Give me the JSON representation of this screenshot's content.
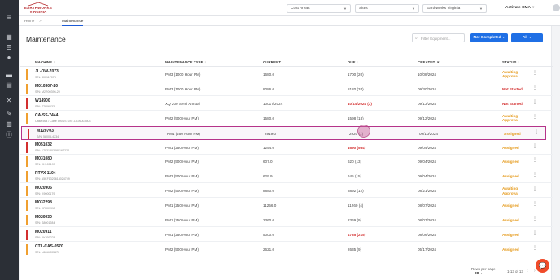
{
  "brand": {
    "logo_line1": "EARTHWORKS",
    "logo_line2": "VIRGINIA"
  },
  "sidebar": {
    "icons": [
      "menu-icon",
      "grid-icon",
      "list-icon",
      "user-icon",
      "truck-icon",
      "building-icon",
      "wrench-icon",
      "tool-icon",
      "chart-icon",
      "info-icon"
    ]
  },
  "topbar": {
    "cost_areas": "Cost Areas",
    "sites": "Sites",
    "company": "Earthworks Virginia",
    "user_name": "Activate CMA"
  },
  "breadcrumb": {
    "home": "Home",
    "current": "Maintenance"
  },
  "page": {
    "title": "Maintenance",
    "filter_placeholder": "Filter Equipment...",
    "status_filter": "Not Completed",
    "all_button": "All"
  },
  "table": {
    "headers": {
      "machine": "MACHINE",
      "type": "MAINTENANCE TYPE",
      "current": "CURRENT",
      "due": "DUE",
      "created": "CREATED",
      "status": "STATUS"
    },
    "rows": [
      {
        "name": "JL-OW-7073",
        "sn": "S/N: 300117073",
        "type": "PM3 (1000 Hour PM)",
        "current": "1680.0",
        "due": "1700 (20)",
        "due_red": false,
        "created": "10/08/2024",
        "status": "Awaiting Approval",
        "status_color": "#e59a1c",
        "flag": "#f0a030",
        "selected": false
      },
      {
        "name": "M010307-20",
        "sn": "S/N: M2R00396-20",
        "type": "PM3 (1000 Hour PM)",
        "current": "8086.0",
        "due": "8120 (34)",
        "due_red": false,
        "created": "09/30/2024",
        "status": "Not Started",
        "status_color": "#d32f2f",
        "flag": "#f0a030",
        "selected": false
      },
      {
        "name": "W14900",
        "sn": "S/N: 77906633",
        "type": "XQ 200 Semi Annual",
        "current": "10017/2024",
        "due": "10/14/2024 (3)",
        "due_red": true,
        "created": "09/13/2024",
        "status": "Not Started",
        "status_color": "#d32f2f",
        "flag": "#d32f2f",
        "selected": false
      },
      {
        "name": "CA-SS-7444",
        "sn": "Case 564 / Case 590SS S/N: JJGN0L5503",
        "type": "PM2 (500 Hour PM)",
        "current": "1580.0",
        "due": "1598 (18)",
        "due_red": false,
        "created": "09/12/2024",
        "status": "Awaiting Approval",
        "status_color": "#e59a1c",
        "flag": "#f0a030",
        "selected": false
      },
      {
        "name": "M120703",
        "sn": "S/N: 58005-4234",
        "type": "PM1 (250 Hour PM)",
        "current": "2919.0",
        "due": "2920 (1)",
        "due_red": false,
        "created": "09/10/2024",
        "status": "Assigned",
        "status_color": "#e59a1c",
        "flag": "#d32f2f",
        "selected": true
      },
      {
        "name": "M051032",
        "sn": "S/N: 17031303280167224",
        "type": "PM1 (250 Hour PM)",
        "current": "1254.0",
        "due": "1690 (564)",
        "due_red": true,
        "created": "09/04/2024",
        "status": "Assigned",
        "status_color": "#e59a1c",
        "flag": "#d32f2f",
        "selected": false
      },
      {
        "name": "M031080",
        "sn": "S/N: KKL00197",
        "type": "PM2 (500 Hour PM)",
        "current": "607.0",
        "due": "620 (13)",
        "due_red": false,
        "created": "09/04/2024",
        "status": "Assigned",
        "status_color": "#e59a1c",
        "flag": "#f0a030",
        "selected": false
      },
      {
        "name": "RTVX 1104",
        "sn": "S/N: A5KF1320614024749",
        "type": "PM2 (500 Hour PM)",
        "current": "629.9",
        "due": "645 (15)",
        "due_red": false,
        "created": "09/04/2024",
        "status": "Assigned",
        "status_color": "#e59a1c",
        "flag": "#f0a030",
        "selected": false
      },
      {
        "name": "M020906",
        "sn": "S/N: K9000179",
        "type": "PM2 (500 Hour PM)",
        "current": "8880.0",
        "due": "8892 (12)",
        "due_red": false,
        "created": "08/21/2024",
        "status": "Awaiting Approval",
        "status_color": "#e59a1c",
        "flag": "#f0a030",
        "selected": false
      },
      {
        "name": "M032298",
        "sn": "S/N: KR001915",
        "type": "PM1 (250 Hour PM)",
        "current": "11256.0",
        "due": "11260 (4)",
        "due_red": false,
        "created": "08/07/2024",
        "status": "Assigned",
        "status_color": "#e59a1c",
        "flag": "#f0a030",
        "selected": false
      },
      {
        "name": "M020930",
        "sn": "S/N: S8001284",
        "type": "PM1 (250 Hour PM)",
        "current": "2360.0",
        "due": "2369 (9)",
        "due_red": false,
        "created": "08/07/2024",
        "status": "Assigned",
        "status_color": "#e59a1c",
        "flag": "#f0a030",
        "selected": false
      },
      {
        "name": "M020911",
        "sn": "S/N: KK300229",
        "type": "PM1 (250 Hour PM)",
        "current": "5000.0",
        "due": "4785 (215)",
        "due_red": true,
        "created": "08/06/2024",
        "status": "Assigned",
        "status_color": "#e59a1c",
        "flag": "#d32f2f",
        "selected": false
      },
      {
        "name": "CTL-CAS-0570",
        "sn": "S/N: N6M4R05570",
        "type": "PM2 (500 Hour PM)",
        "current": "2621.0",
        "due": "2635 (9)",
        "due_red": false,
        "created": "05/17/2024",
        "status": "Assigned",
        "status_color": "#e59a1c",
        "flag": "#f0a030",
        "selected": false
      }
    ]
  },
  "pagination": {
    "rows_per_page_label": "Rows per page",
    "rows_per_page_value": "20",
    "range": "1-13 of 13"
  },
  "colors": {
    "accent": "#1f6fe5",
    "sidebar": "#2b2f36",
    "selection": "#b5338a",
    "brand_red": "#b5262a"
  }
}
